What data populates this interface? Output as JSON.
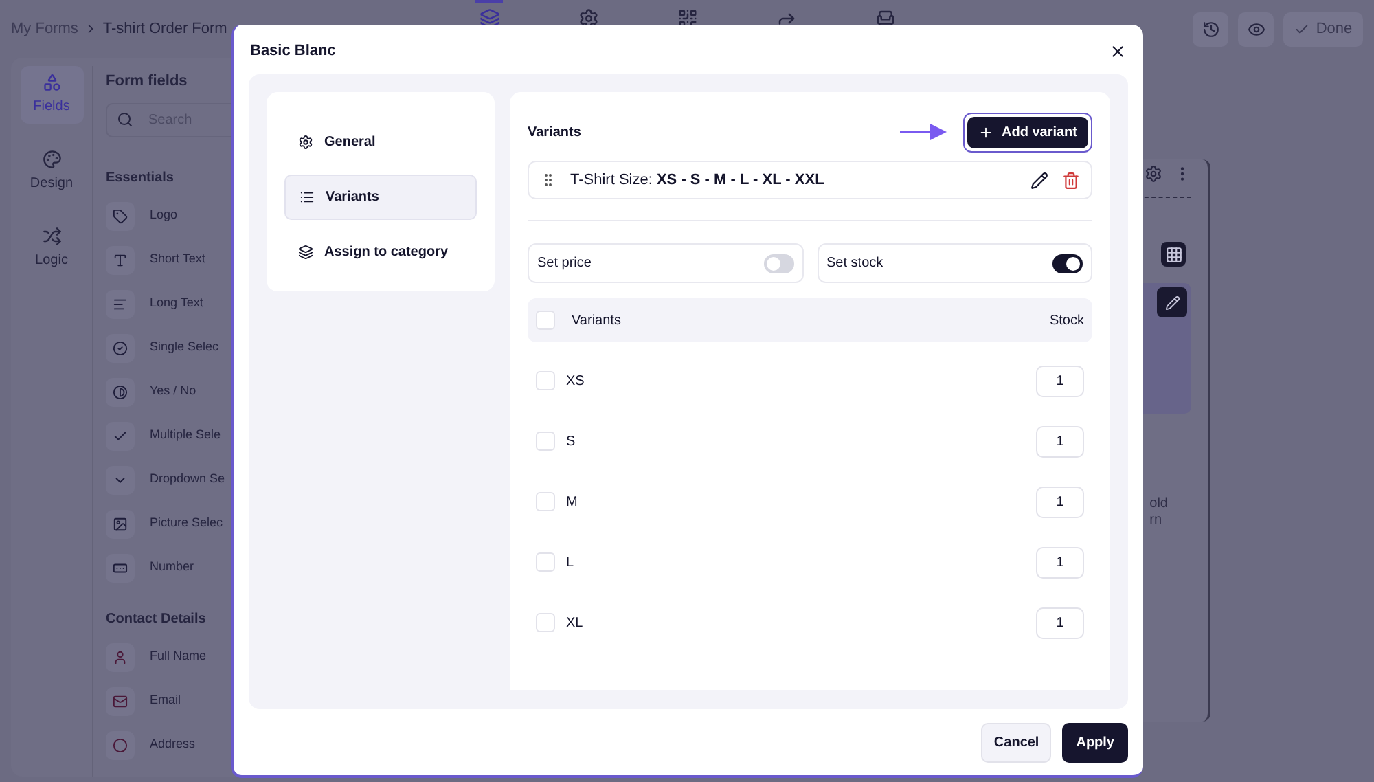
{
  "breadcrumb": [
    {
      "label": "My Forms"
    },
    {
      "label": "T-shirt Order Form"
    }
  ],
  "toolbar": [
    {
      "selected": true
    },
    {
      "selected": false
    },
    {
      "selected": false
    },
    {
      "selected": false
    },
    {
      "selected": false
    }
  ],
  "top_actions": {
    "done": "Done"
  },
  "rail": [
    {
      "label": "Fields",
      "selected": true
    },
    {
      "label": "Design",
      "selected": false
    },
    {
      "label": "Logic",
      "selected": false
    }
  ],
  "form_fields": {
    "title": "Form fields",
    "search_placeholder": "Search",
    "sections": [
      {
        "title": "Essentials",
        "items": [
          "Logo",
          "Short Text",
          "Long Text",
          "Single Selec",
          "Yes / No",
          "Multiple Sele",
          "Dropdown Se",
          "Picture Selec",
          "Number"
        ]
      },
      {
        "title": "Contact Details",
        "items": [
          "Full Name",
          "Email",
          "Address"
        ]
      }
    ]
  },
  "canvas": {
    "texts": [
      "old",
      "rn"
    ]
  },
  "modal": {
    "title": "Basic Blanc",
    "nav": [
      {
        "label": "General",
        "selected": false
      },
      {
        "label": "Variants",
        "selected": true
      },
      {
        "label": "Assign to category",
        "selected": false
      }
    ],
    "section_title": "Variants",
    "add_button": "Add variant",
    "variant_group": "T-Shirt Size: **XS - S - M - L - XL - XXL**",
    "toggles": [
      {
        "label": "Set price",
        "on": false
      },
      {
        "label": "Set stock",
        "on": true
      }
    ],
    "table": {
      "columns": [
        "Variants",
        "Stock"
      ],
      "header_checked": false,
      "rows": [
        {
          "name": "XS",
          "checked": false,
          "stock": "1"
        },
        {
          "name": "S",
          "checked": false,
          "stock": "1"
        },
        {
          "name": "M",
          "checked": false,
          "stock": "1"
        },
        {
          "name": "L",
          "checked": false,
          "stock": "1"
        },
        {
          "name": "XL",
          "checked": false,
          "stock": "1"
        }
      ]
    },
    "buttons": [
      {
        "label": "Cancel",
        "kind": "secondary"
      },
      {
        "label": "Apply",
        "kind": "primary"
      }
    ]
  }
}
